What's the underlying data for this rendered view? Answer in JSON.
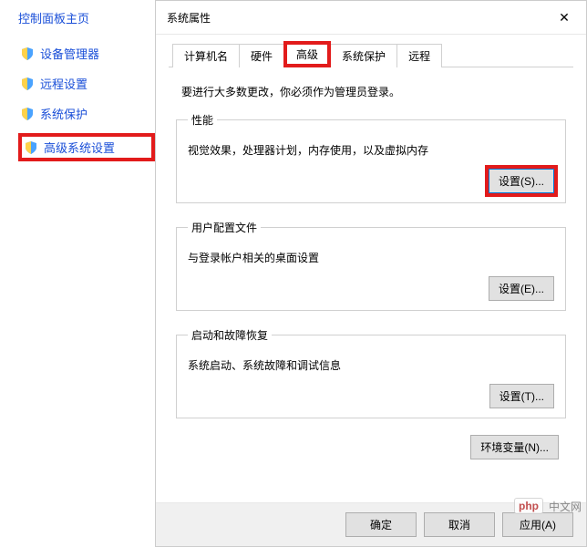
{
  "sidebar": {
    "title": "控制面板主页",
    "items": [
      {
        "label": "设备管理器"
      },
      {
        "label": "远程设置"
      },
      {
        "label": "系统保护"
      },
      {
        "label": "高级系统设置"
      }
    ]
  },
  "dialog": {
    "title": "系统属性",
    "tabs": [
      {
        "label": "计算机名"
      },
      {
        "label": "硬件"
      },
      {
        "label": "高级"
      },
      {
        "label": "系统保护"
      },
      {
        "label": "远程"
      }
    ],
    "admin_note": "要进行大多数更改，你必须作为管理员登录。",
    "performance": {
      "legend": "性能",
      "desc": "视觉效果，处理器计划，内存使用，以及虚拟内存",
      "button": "设置(S)..."
    },
    "user_profile": {
      "legend": "用户配置文件",
      "desc": "与登录帐户相关的桌面设置",
      "button": "设置(E)..."
    },
    "startup": {
      "legend": "启动和故障恢复",
      "desc": "系统启动、系统故障和调试信息",
      "button": "设置(T)..."
    },
    "env_button": "环境变量(N)...",
    "ok": "确定",
    "cancel": "取消",
    "apply": "应用(A)"
  },
  "watermark": {
    "logo_prefix": "php",
    "text": "中文网"
  }
}
